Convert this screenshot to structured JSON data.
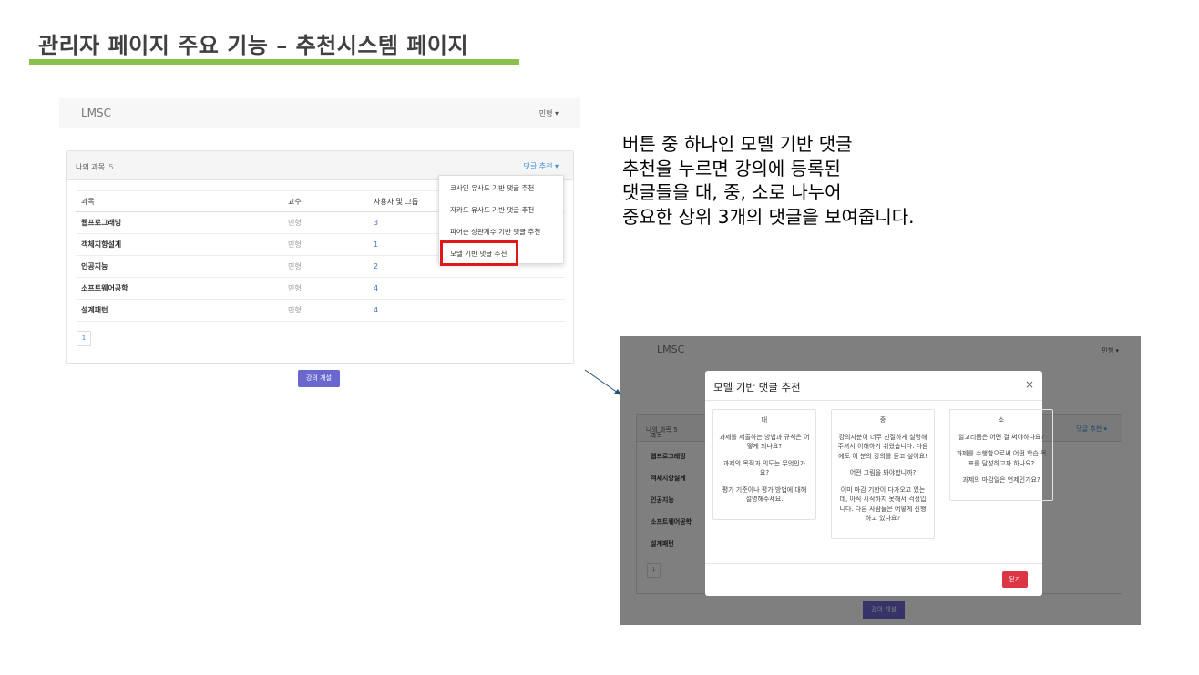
{
  "slide": {
    "title": "관리자 페이지 주요 기능 – 추천시스템 페이지",
    "accent_color": "#8cc152",
    "description": "버튼 중 하나인 모델 기반 댓글\n추천을 누르면 강의에 등록된\n댓글들을 대, 중, 소로 나누어\n중요한 상위 3개의 댓글을 보여줍니다."
  },
  "app": {
    "brand": "LMSC",
    "user_menu": "민형 ▾",
    "panel_title": "나의 과목",
    "course_count": "5",
    "recommend_button": "댓글 추천 ▾",
    "columns": [
      "과목",
      "교수",
      "사용자 및 그룹"
    ],
    "courses": [
      {
        "name": "웹프로그래밍",
        "professor": "민형",
        "users": "3"
      },
      {
        "name": "객체지향설계",
        "professor": "민형",
        "users": "1"
      },
      {
        "name": "인공지능",
        "professor": "민형",
        "users": "2"
      },
      {
        "name": "소프트웨어공학",
        "professor": "민형",
        "users": "4"
      },
      {
        "name": "설계패턴",
        "professor": "민형",
        "users": "4"
      }
    ],
    "page": "1",
    "open_course_button": "강의 개설",
    "dropdown": [
      "코사인 유사도 기반 댓글 추천",
      "자카드 유사도 기반 댓글 추천",
      "피어슨 상관계수 기반 댓글 추천",
      "모델 기반 댓글 추천"
    ],
    "highlight_color": "#e01818"
  },
  "modal": {
    "title": "모델 기반 댓글 추천",
    "close_x": "×",
    "close_button": "닫기",
    "groups": [
      {
        "header": "대",
        "comments": [
          "과제를 제출하는 방법과 규칙은 어떻게 되나요?",
          "과제의 목적과 의도는 무엇인가요?",
          "평가 기준이나 평가 방법에 대해 설명해주세요."
        ]
      },
      {
        "header": "중",
        "comments": [
          "강의자분이 너무 친절하게 설명해주셔서 이해하기 쉬웠습니다. 다음에도 이 분의 강의를 듣고 싶어요!",
          "어떤 그림을 봐야합니까?",
          "이미 마감 기한이 다가오고 있는데, 아직 시작하지 못해서 걱정입니다. 다른 사람들은 어떻게 진행하고 있나요?"
        ]
      },
      {
        "header": "소",
        "comments": [
          "알고리즘은 어떤 걸 써야하나요?",
          "과제를 수행함으로써 어떤 학습 목표를 달성하고자 하나요?",
          "과제의 마감일은 언제인가요?"
        ]
      }
    ]
  }
}
